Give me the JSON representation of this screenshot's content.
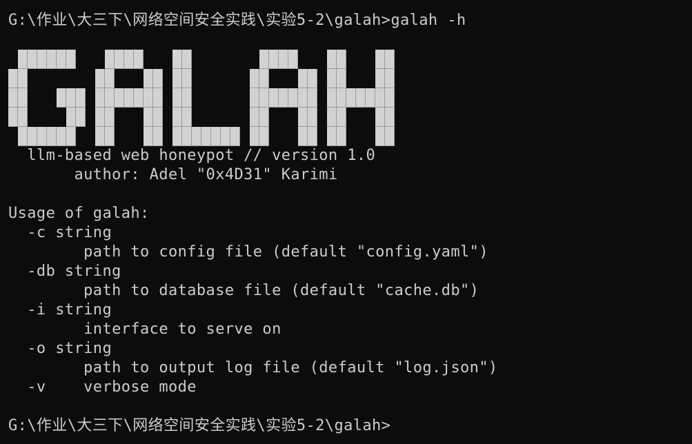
{
  "terminal": {
    "command_line": {
      "prompt": "G:\\作业\\大三下\\网络空间安全实践\\实验5-2\\galah>",
      "command": "galah -h"
    },
    "banner": {
      "logo_text": "GALAH",
      "tagline": "  llm-based web honeypot // version 1.0",
      "author": "       author: Adel \"0x4D31\" Karimi"
    },
    "usage": {
      "heading": "Usage of galah:",
      "options": [
        {
          "flag": "  -c string",
          "description": "        path to config file (default \"config.yaml\")"
        },
        {
          "flag": "  -db string",
          "description": "        path to database file (default \"cache.db\")"
        },
        {
          "flag": "  -i string",
          "description": "        interface to serve on"
        },
        {
          "flag": "  -o string",
          "description": "        path to output log file (default \"log.json\")"
        }
      ],
      "verbose": "  -v    verbose mode"
    },
    "final_prompt": "G:\\作业\\大三下\\网络空间安全实践\\实验5-2\\galah>"
  },
  "colors": {
    "background": "#0c0c0c",
    "text": "#cccccc",
    "logo_block": "#d2d2d2"
  }
}
